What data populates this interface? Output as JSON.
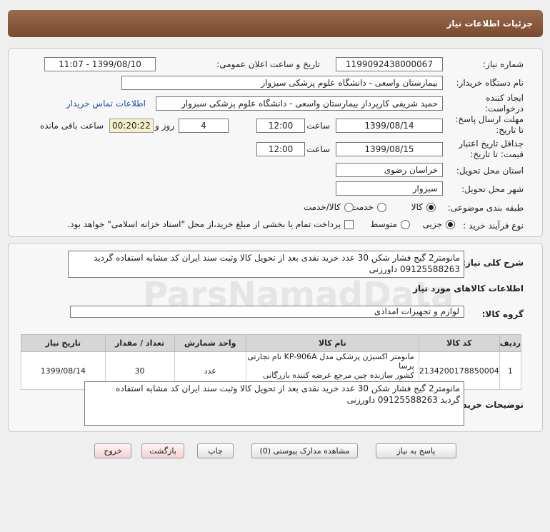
{
  "header": {
    "title": "جزئیات اطلاعات نیاز"
  },
  "form": {
    "need_number_label": "شماره نیاز:",
    "need_number": "1199092438000067",
    "announce_label": "تاریخ و ساعت اعلان عمومی:",
    "announce_value": "1399/08/10 - 11:07",
    "buyer_org_label": "نام دستگاه خریدار:",
    "buyer_org": "بیمارستان واسعی - دانشگاه علوم پزشکی سبزوار",
    "creator_label_1": "ایجاد کننده",
    "creator_label_2": "درخواست:",
    "creator": "حمید شریفی کارپرداز بیمارستان واسعی - دانشگاه علوم پزشکی سبزوار",
    "contact_link": "اطلاعات تماس خریدار",
    "deadline_label_1": "مهلت ارسال پاسخ:",
    "deadline_label_2": "تا تاریخ:",
    "deadline_date": "1399/08/14",
    "time_label": "ساعت",
    "deadline_time": "12:00",
    "days_value": "4",
    "days_label": "روز و",
    "countdown": "00:20:22",
    "remaining_label": "ساعت باقی مانده",
    "validity_label_1": "جداقل تاریخ اعتبار",
    "validity_label_2": "قیمت: تا تاریخ:",
    "validity_date": "1399/08/15",
    "validity_time": "12:00",
    "province_label": "استان محل تحویل:",
    "province": "خراسان رضوی",
    "city_label": "شهر محل تحویل:",
    "city": "سبزوار",
    "category_label": "طبقه بندی موضوعی:",
    "category_options": [
      "کالا",
      "خدمت",
      "کالا/خدمت"
    ],
    "purchase_label": "نوع فرآیند خرید :",
    "purchase_options": [
      "جزیی",
      "متوسط"
    ],
    "payment_note": "پرداخت تمام یا بخشی از مبلغ خرید،از محل \"اسناد خزانه اسلامی\" خواهد بود."
  },
  "details": {
    "summary_label": "شرح کلی نیاز:",
    "summary_line1": "مانومتر2 گیج  فشار شکن  30 عدد خرید نقدی بعد از تحویل کالا وثبت سند  ایران کد مشابه استفاده گردید",
    "summary_line2": "09125588263 داورزنی",
    "goods_info_title": "اطلاعات کالاهای مورد نیاز",
    "goods_group_label": "گروه کالا:",
    "goods_group": "لوازم و تجهیزات امدادی",
    "table": {
      "headers": [
        "ردیف",
        "کد کالا",
        "نام کالا",
        "واحد شمارش",
        "تعداد / مقدار",
        "تاریخ نیاز"
      ],
      "rows": [
        {
          "index": "1",
          "code": "2134200178850004",
          "name_line1": "مانومتر اکسیژن پزشکی مدل KP-906A نام تجارتی پرسا",
          "name_line2": "کشور سازنده چین مرجع عرضه کننده بازرگانی پرسا",
          "unit": "عدد",
          "qty": "30",
          "date": "1399/08/14"
        }
      ]
    },
    "buyer_notes_label": "توضیحات خریدار:",
    "buyer_notes_line1": "مانومتر2 گیج  فشار شکن  30 عدد خرید نقدی بعد از تحویل کالا وثبت سند  ایران کد مشابه استفاده",
    "buyer_notes_line2": "گردید 09125588263 داورزنی"
  },
  "buttons": {
    "reply": "پاسخ به نیاز",
    "attachments": "مشاهده مدارک پیوستی (0)",
    "print": "چاپ",
    "back": "بازگشت",
    "exit": "خروج"
  }
}
